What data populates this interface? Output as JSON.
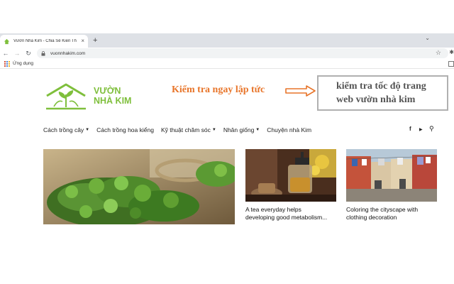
{
  "browser": {
    "tab_title": "Vườn Nhà Kim - Chia Sẻ Kiến Th",
    "tab_close": "×",
    "new_tab": "+",
    "url": "vuonnhakim.com",
    "bookmark_label": "Ứng dụng"
  },
  "site": {
    "logo_line1": "VƯỜN",
    "logo_line2": "NHÀ KIM",
    "promo_text": "Kiểm tra ngay lập tức",
    "promo_box_line1": "kiểm tra tốc độ trang",
    "promo_box_line2": "web vườn nhà kim",
    "colors": {
      "brand_green": "#7fbf3c",
      "promo_orange": "#e8752a"
    }
  },
  "menu": {
    "items": [
      {
        "label": "Cách trồng cây",
        "has_dropdown": true
      },
      {
        "label": "Cách trồng hoa kiểng",
        "has_dropdown": false
      },
      {
        "label": "Kỹ thuật chăm sóc",
        "has_dropdown": true
      },
      {
        "label": "Nhân giống",
        "has_dropdown": true
      },
      {
        "label": "Chuyện nhà Kim",
        "has_dropdown": false
      }
    ],
    "social_icons": [
      "facebook-icon",
      "youtube-icon",
      "search-icon"
    ],
    "facebook": "f",
    "youtube": "▶",
    "search": "⚲"
  },
  "cards": [
    {
      "image": "watercress-plants-photo",
      "title_line1": "",
      "title_line2": ""
    },
    {
      "image": "teapot-photo",
      "title_line1": "A tea everyday helps",
      "title_line2": "developing good metabolism..."
    },
    {
      "image": "street-clothesline-photo",
      "title_line1": "Coloring the cityscape with",
      "title_line2": "clothing decoration"
    }
  ]
}
